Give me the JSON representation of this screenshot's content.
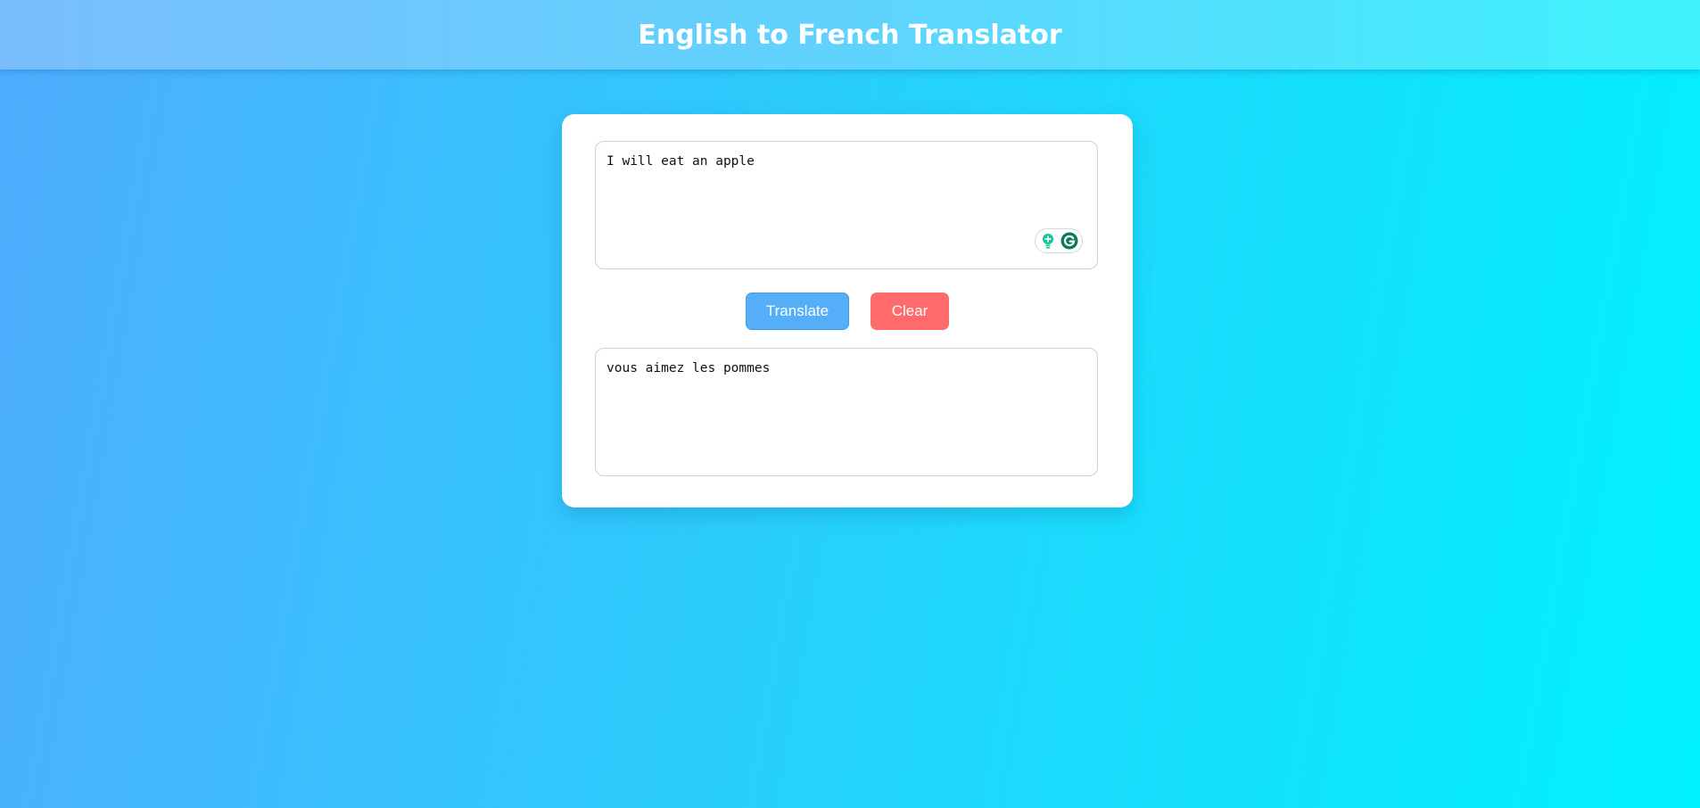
{
  "header": {
    "title": "English to French Translator"
  },
  "translator": {
    "input_text": "I will eat an apple",
    "output_text": "vous aimez les pommes",
    "translate_label": "Translate",
    "clear_label": "Clear"
  },
  "icons": {
    "grammarly_suggestion": "lightbulb-plus-icon",
    "grammarly_logo": "grammarly-g-icon"
  },
  "colors": {
    "translate_button": "#54aef8",
    "clear_button": "#ff6b6b",
    "grammarly_green": "#15c39a",
    "grammarly_dark": "#0b7a5e"
  }
}
